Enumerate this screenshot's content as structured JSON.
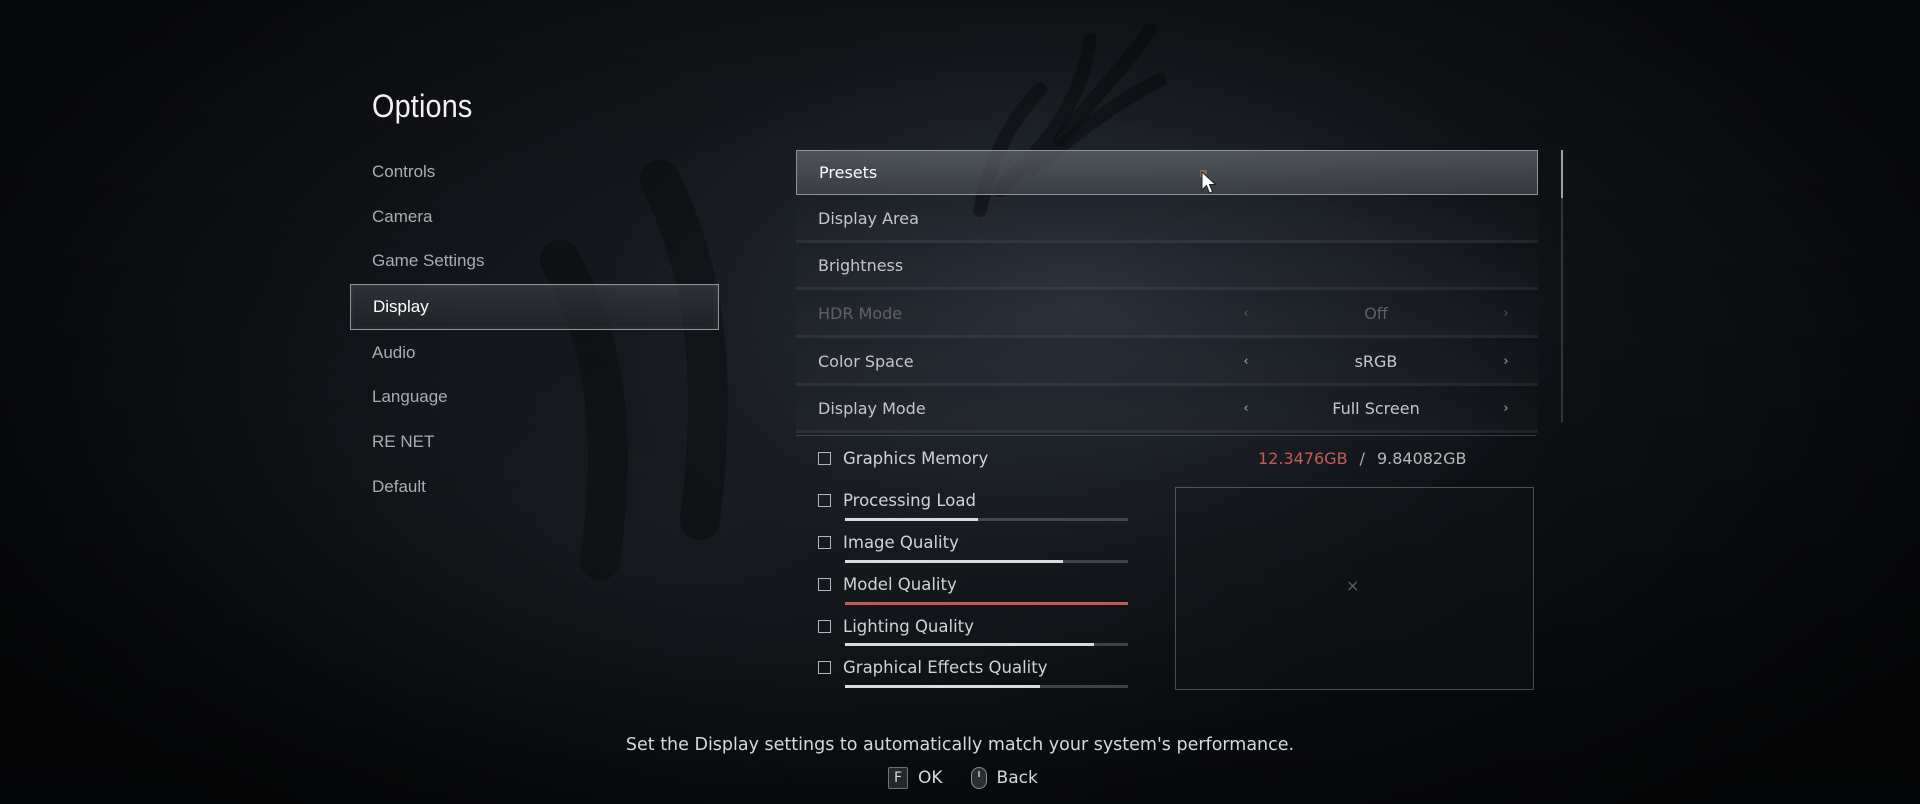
{
  "title": "Options",
  "nav": {
    "items": [
      {
        "label": "Controls"
      },
      {
        "label": "Camera"
      },
      {
        "label": "Game Settings"
      },
      {
        "label": "Display"
      },
      {
        "label": "Audio"
      },
      {
        "label": "Language"
      },
      {
        "label": "RE NET"
      },
      {
        "label": "Default"
      }
    ],
    "active": "Display"
  },
  "settings": {
    "rows": [
      {
        "label": "Presets"
      },
      {
        "label": "Display Area"
      },
      {
        "label": "Brightness"
      },
      {
        "label": "HDR Mode",
        "value": "Off",
        "disabled": true
      },
      {
        "label": "Color Space",
        "value": "sRGB"
      },
      {
        "label": "Display Mode",
        "value": "Full Screen"
      }
    ],
    "selected": "Presets",
    "arrow_left": "‹",
    "arrow_right": "›"
  },
  "graphics": {
    "memory_label": "Graphics Memory",
    "memory_used": "12.3476GB",
    "memory_separator": "/",
    "memory_total": "9.84082GB",
    "items": [
      {
        "label": "Processing Load",
        "level": 0.47
      },
      {
        "label": "Image Quality",
        "level": 0.77
      },
      {
        "label": "Model Quality",
        "level": 1.0,
        "over_limit": true
      },
      {
        "label": "Lighting Quality",
        "level": 0.88
      },
      {
        "label": "Graphical Effects Quality",
        "level": 0.69
      }
    ]
  },
  "preview_mark": "×",
  "hint": "Set the Display settings to automatically match your system's performance.",
  "footer": {
    "ok_key": "F",
    "ok_label": "OK",
    "back_label": "Back"
  },
  "colors": {
    "over_limit": "#c15a55",
    "text": "#c4c7ca"
  }
}
